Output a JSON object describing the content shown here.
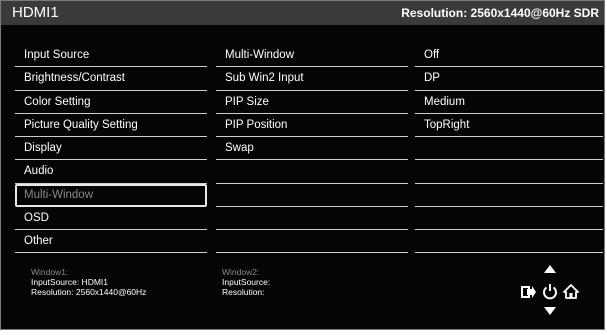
{
  "header": {
    "title": "HDMI1",
    "resolution": "Resolution: 2560x1440@60Hz SDR"
  },
  "menu": {
    "items": [
      {
        "label": "Input Source"
      },
      {
        "label": "Brightness/Contrast"
      },
      {
        "label": "Color Setting"
      },
      {
        "label": "Picture Quality Setting"
      },
      {
        "label": "Display"
      },
      {
        "label": "Audio"
      },
      {
        "label": "Multi-Window",
        "selected": true
      },
      {
        "label": "OSD"
      },
      {
        "label": "Other"
      }
    ]
  },
  "submenu": {
    "items": [
      "Multi-Window",
      "Sub Win2 Input",
      "PIP Size",
      "PIP Position",
      "Swap",
      "",
      "",
      "",
      ""
    ]
  },
  "values": {
    "items": [
      "Off",
      "DP",
      "Medium",
      "TopRight",
      "",
      "",
      "",
      "",
      ""
    ]
  },
  "footer": {
    "window1": {
      "title": "Window1:",
      "input": "InputSource: HDMI1",
      "resolution": "Resolution: 2560x1440@60Hz"
    },
    "window2": {
      "title": "Window2:",
      "input": "InputSource:",
      "resolution": "Resolution:"
    }
  },
  "controls": {
    "icons": [
      "up-arrow-icon",
      "enter-icon",
      "power-icon",
      "home-icon",
      "down-arrow-icon"
    ]
  },
  "colors": {
    "background": "#050505",
    "header": "#3a3a3a",
    "text": "#ffffff",
    "dim_text": "#8a8a8a",
    "divider": "#cfcfcf"
  }
}
